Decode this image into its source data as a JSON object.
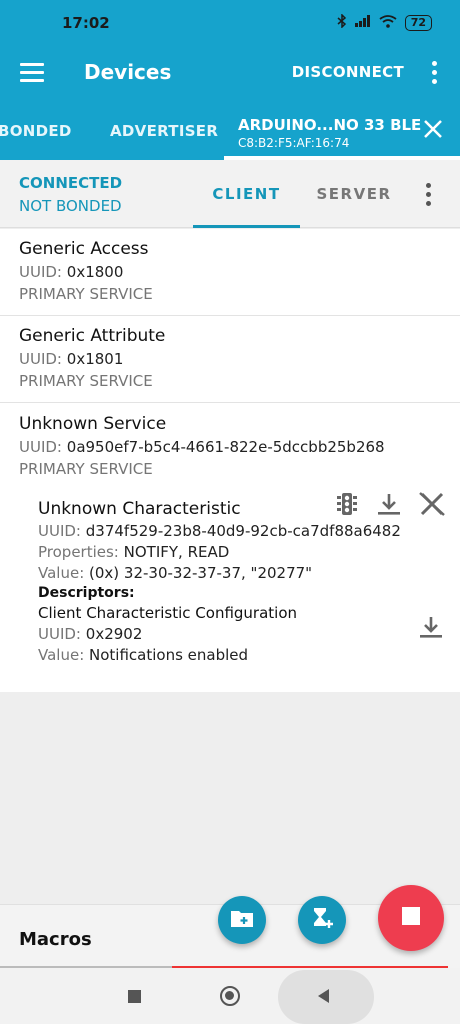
{
  "status": {
    "time": "17:02",
    "battery": "72"
  },
  "appbar": {
    "title": "Devices",
    "disconnect": "DISCONNECT"
  },
  "device_tabs": {
    "bonded": "BONDED",
    "advertiser": "ADVERTISER",
    "active_name": "ARDUINO...NO 33 BLE",
    "active_mac": "C8:B2:F5:AF:16:74"
  },
  "connection": {
    "state": "CONNECTED",
    "bond_state": "NOT BONDED"
  },
  "mode_tabs": {
    "client": "CLIENT",
    "server": "SERVER"
  },
  "services": [
    {
      "name": "Generic Access",
      "uuid_label": "UUID:",
      "uuid": "0x1800",
      "type": "PRIMARY SERVICE"
    },
    {
      "name": "Generic Attribute",
      "uuid_label": "UUID:",
      "uuid": "0x1801",
      "type": "PRIMARY SERVICE"
    },
    {
      "name": "Unknown Service",
      "uuid_label": "UUID:",
      "uuid": "0a950ef7-b5c4-4661-822e-5dccbb25b268",
      "type": "PRIMARY SERVICE"
    }
  ],
  "characteristic": {
    "name": "Unknown Characteristic",
    "uuid_label": "UUID:",
    "uuid": "d374f529-23b8-40d9-92cb-ca7df88a6482",
    "properties_label": "Properties:",
    "properties": "NOTIFY, READ",
    "value_label": "Value:",
    "value": "(0x) 32-30-32-37-37, \"20277\"",
    "descriptors_label": "Descriptors:",
    "descriptor": {
      "name": "Client Characteristic Configuration",
      "uuid_label": "UUID:",
      "uuid": "0x2902",
      "value_label": "Value:",
      "value": "Notifications enabled"
    }
  },
  "macros": {
    "label": "Macros"
  },
  "colors": {
    "primary": "#16a3cc",
    "accent_text": "#1596b9",
    "record": "#ee3d4f"
  }
}
